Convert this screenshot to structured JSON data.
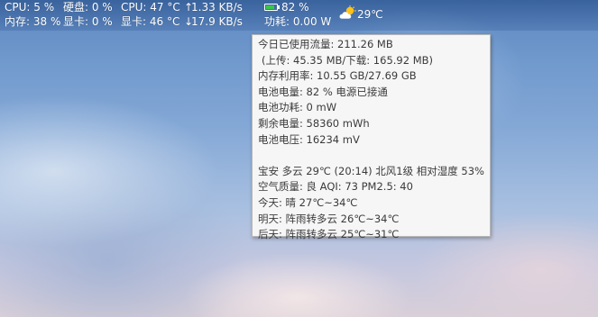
{
  "statbar": {
    "row1": {
      "cpu_usage": "CPU: 5 %",
      "disk": "硬盘: 0 %",
      "cpu_temp": "CPU: 47 °C",
      "upload_arrow": "↑",
      "upload_speed": "1.33 KB/s",
      "battery": "82 %"
    },
    "row2": {
      "memory": "内存: 38 %",
      "gpu_usage": "显卡: 0 %",
      "gpu_temp": "显卡: 46 °C",
      "download_arrow": "↓",
      "download_speed": "17.9 KB/s",
      "power": "功耗: 0.00 W"
    },
    "weather": "29℃",
    "battery_level": 0.82,
    "battery_color": "#37c84a",
    "weather_icon": "partly-cloudy-icon"
  },
  "tooltip": {
    "traffic_today": "今日已使用流量: 211.26 MB",
    "traffic_detail": "(上传: 45.35 MB/下载: 165.92 MB)",
    "memory_usage": "内存利用率: 10.55 GB/27.69 GB",
    "battery_level": "电池电量: 82 % 电源已接通",
    "battery_power": "电池功耗:  0 mW",
    "remaining_capacity": "剩余电量:  58360 mWh",
    "battery_voltage": "电池电压:  16234 mV",
    "weather_now": "宝安 多云 29℃ (20:14) 北风1级 相对湿度 53%",
    "air_quality": "空气质量: 良 AQI: 73 PM2.5: 40",
    "forecast_today": "今天: 晴 27℃~34℃",
    "forecast_tomorrow": "明天: 阵雨转多云 26℃~34℃",
    "forecast_day_after": "后天: 阵雨转多云 25℃~31℃"
  }
}
